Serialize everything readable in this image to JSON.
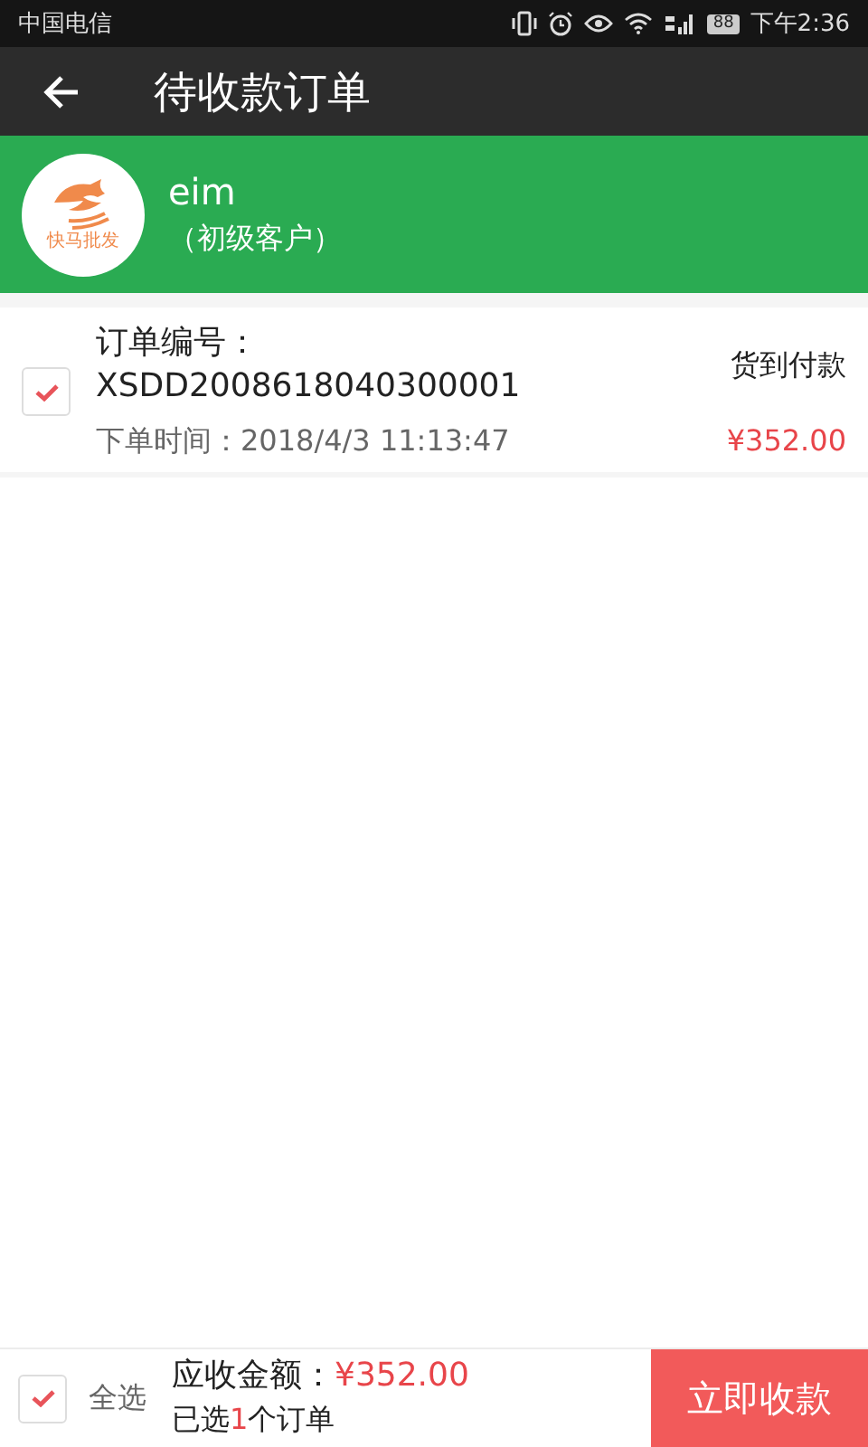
{
  "status_bar": {
    "carrier": "中国电信",
    "battery": "88",
    "time": "下午2:36"
  },
  "app_bar": {
    "title": "待收款订单"
  },
  "customer": {
    "logo_text": "快马批发",
    "name": "eim",
    "level": "（初级客户）"
  },
  "orders": [
    {
      "number_label": "订单编号：",
      "number": "XSDD2008618040300001",
      "payment": "货到付款",
      "time_label": "下单时间：",
      "time": "2018/4/3 11:13:47",
      "amount": "¥352.00",
      "checked": true
    }
  ],
  "footer": {
    "select_all": {
      "label": "全选",
      "checked": true
    },
    "total_label": "应收金额：",
    "total": "¥352.00",
    "selected_prefix": "已选",
    "selected_count": "1",
    "selected_suffix": "个订单",
    "button": "立即收款"
  }
}
